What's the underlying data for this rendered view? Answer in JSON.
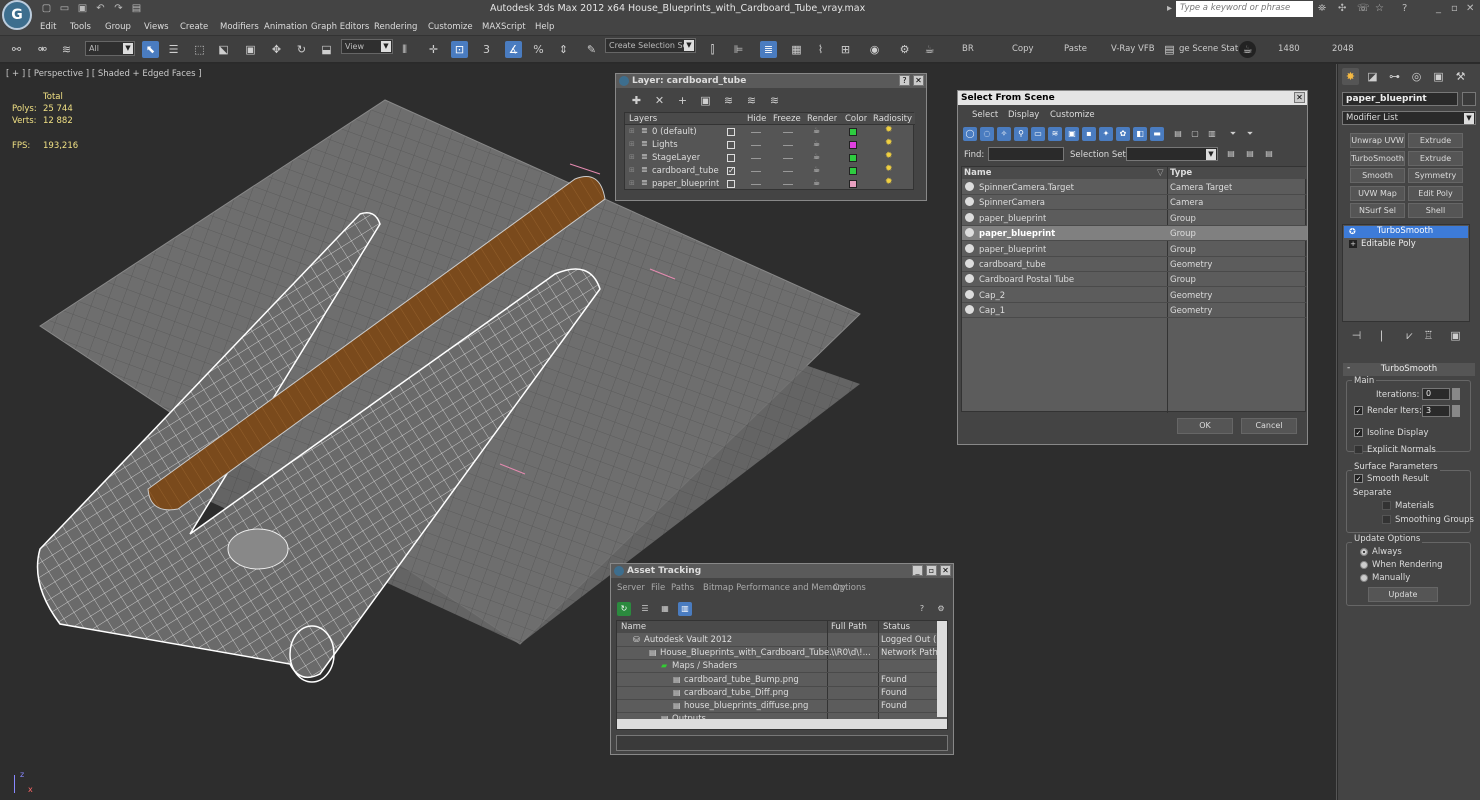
{
  "titlebar": {
    "title": "Autodesk 3ds Max  2012 x64      House_Blueprints_with_Cardboard_Tube_vray.max",
    "search_placeholder": "Type a keyword or phrase"
  },
  "menu": [
    "Edit",
    "Tools",
    "Group",
    "Views",
    "Create",
    "Modifiers",
    "Animation",
    "Graph Editors",
    "Rendering",
    "Customize",
    "MAXScript",
    "Help"
  ],
  "toolbar": {
    "filter": "All",
    "coord": "View",
    "selset": "Create Selection Se",
    "labels": [
      "BR",
      "Copy",
      "Paste",
      "V-Ray VFB",
      "ge Scene Stat",
      "1480",
      "2048"
    ],
    "three": "3",
    "pct": "%"
  },
  "viewport": {
    "label": "[ + ] [ Perspective ] [ Shaded + Edged Faces ]",
    "stats": {
      "header": "Total",
      "polys_label": "Polys:",
      "polys": "25 744",
      "verts_label": "Verts:",
      "verts": "12 882",
      "fps_label": "FPS:",
      "fps": "193,216"
    }
  },
  "layer_window": {
    "title": "Layer: cardboard_tube",
    "columns": [
      "Layers",
      "Hide",
      "Freeze",
      "Render",
      "Color",
      "Radiosity"
    ],
    "rows": [
      {
        "name": "0 (default)",
        "check": "",
        "color": "#2ecc40"
      },
      {
        "name": "Lights",
        "check": "",
        "color": "#e040e0"
      },
      {
        "name": "StageLayer",
        "check": "",
        "color": "#2ecc40"
      },
      {
        "name": "cardboard_tube",
        "check": "✓",
        "color": "#2ecc40"
      },
      {
        "name": "paper_blueprint",
        "check": "",
        "color": "#e8a0c0"
      }
    ]
  },
  "select_scene": {
    "title": "Select From Scene",
    "menu": [
      "Select",
      "Display",
      "Customize"
    ],
    "find_label": "Find:",
    "selset_label": "Selection Set:",
    "col_name": "Name",
    "col_type": "Type",
    "rows": [
      {
        "name": "SpinnerCamera.Target",
        "type": "Camera Target",
        "sel": false
      },
      {
        "name": "SpinnerCamera",
        "type": "Camera",
        "sel": false
      },
      {
        "name": "paper_blueprint",
        "type": "Group",
        "sel": false
      },
      {
        "name": "paper_blueprint",
        "type": "Group",
        "sel": true
      },
      {
        "name": "paper_blueprint",
        "type": "Group",
        "sel": false
      },
      {
        "name": "cardboard_tube",
        "type": "Geometry",
        "sel": false
      },
      {
        "name": "Cardboard Postal Tube",
        "type": "Group",
        "sel": false
      },
      {
        "name": "Cap_2",
        "type": "Geometry",
        "sel": false
      },
      {
        "name": "Cap_1",
        "type": "Geometry",
        "sel": false
      }
    ],
    "ok": "OK",
    "cancel": "Cancel"
  },
  "asset": {
    "title": "Asset Tracking",
    "menu": [
      "Server",
      "File",
      "Paths",
      "Bitmap Performance and Memory",
      "Options"
    ],
    "columns": [
      "Name",
      "Full Path",
      "Status"
    ],
    "rows": [
      {
        "name": "Autodesk Vault 2012",
        "path": "",
        "status": "Logged Out (..."
      },
      {
        "name": "House_Blueprints_with_Cardboard_Tube...",
        "path": "\\\\R0\\d\\!...",
        "status": "Network Path"
      },
      {
        "name": "Maps / Shaders",
        "path": "",
        "status": ""
      },
      {
        "name": "cardboard_tube_Bump.png",
        "path": "",
        "status": "Found"
      },
      {
        "name": "cardboard_tube_Diff.png",
        "path": "",
        "status": "Found"
      },
      {
        "name": "house_blueprints_diffuse.png",
        "path": "",
        "status": "Found"
      },
      {
        "name": "Outputs",
        "path": "",
        "status": ""
      }
    ]
  },
  "cmd": {
    "object_name": "paper_blueprint",
    "modifier_list": "Modifier List",
    "buttons": [
      "Unwrap UVW",
      "Extrude",
      "TurboSmooth",
      "Extrude",
      "Smooth",
      "Symmetry",
      "UVW Map",
      "Edit Poly",
      "NSurf Sel",
      "Shell"
    ],
    "stack": [
      "TurboSmooth",
      "Editable Poly"
    ],
    "ts": {
      "title": "TurboSmooth",
      "main": "Main",
      "iterations_label": "Iterations:",
      "iterations": "0",
      "render_iters_label": "Render Iters:",
      "render_iters": "3",
      "isoline": "Isoline Display",
      "explicit": "Explicit Normals",
      "surface": "Surface Parameters",
      "smooth_result": "Smooth Result",
      "separate": "Separate",
      "materials": "Materials",
      "smoothing_groups": "Smoothing Groups",
      "update_options": "Update Options",
      "always": "Always",
      "when_rendering": "When Rendering",
      "manually": "Manually",
      "update": "Update"
    }
  },
  "axis": {
    "z": "z",
    "x": "x"
  }
}
